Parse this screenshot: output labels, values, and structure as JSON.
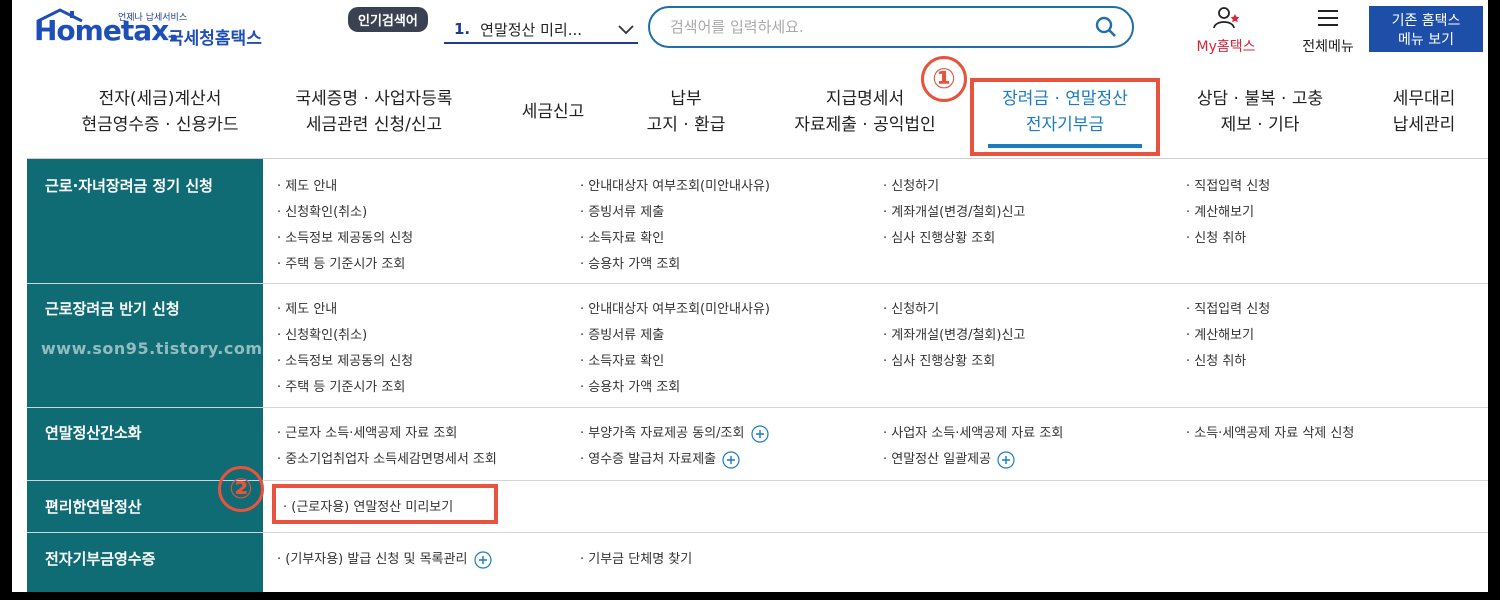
{
  "header": {
    "logo": {
      "tagline": "언제나 납세서비스",
      "brand": "Hometax.",
      "name": "국세청홈택스"
    },
    "popular_label": "인기검색어",
    "popular_rank": "1.",
    "popular_text": "연말정산 미리...",
    "search": {
      "placeholder": "검색어를 입력하세요."
    },
    "my_label": "My홈택스",
    "allmenu_label": "전체메뉴",
    "old_button": {
      "line1": "기존 홈택스",
      "line2": "메뉴 보기"
    }
  },
  "gnb": [
    {
      "line1": "전자(세금)계산서",
      "line2": "현금영수증 · 신용카드"
    },
    {
      "line1": "국세증명 · 사업자등록",
      "line2": "세금관련 신청/신고"
    },
    {
      "line1": "세금신고",
      "line2": ""
    },
    {
      "line1": "납부",
      "line2": "고지 · 환급"
    },
    {
      "line1": "지급명세서",
      "line2": "자료제출 · 공익법인"
    },
    {
      "line1": "장려금 · 연말정산",
      "line2": "전자기부금"
    },
    {
      "line1": "상담 · 불복 · 고충",
      "line2": "제보 · 기타"
    },
    {
      "line1": "세무대리",
      "line2": "납세관리"
    }
  ],
  "annotations": {
    "one": "①",
    "two": "②"
  },
  "watermark": "www.son95.tistory.com",
  "sections": [
    {
      "title": "근로·자녀장려금 정기 신청",
      "links": [
        "· 제도 안내",
        "· 안내대상자 여부조회(미안내사유)",
        "· 신청하기",
        "· 직접입력 신청",
        "· 신청확인(취소)",
        "· 증빙서류 제출",
        "· 계좌개설(변경/철회)신고",
        "· 계산해보기",
        "· 소득정보 제공동의 신청",
        "· 소득자료 확인",
        "· 심사 진행상황 조회",
        "· 신청 취하",
        "· 주택 등 기준시가 조회",
        "· 승용차 가액 조회"
      ]
    },
    {
      "title": "근로장려금 반기 신청",
      "links": [
        "· 제도 안내",
        "· 안내대상자 여부조회(미안내사유)",
        "· 신청하기",
        "· 직접입력 신청",
        "· 신청확인(취소)",
        "· 증빙서류 제출",
        "· 계좌개설(변경/철회)신고",
        "· 계산해보기",
        "· 소득정보 제공동의 신청",
        "· 소득자료 확인",
        "· 심사 진행상황 조회",
        "· 신청 취하",
        "· 주택 등 기준시가 조회",
        "· 승용차 가액 조회"
      ]
    },
    {
      "title": "연말정산간소화",
      "links": [
        "· 근로자 소득·세액공제 자료 조회",
        "· 부양가족 자료제공 동의/조회",
        "· 사업자 소득·세액공제 자료 조회",
        "· 소득·세액공제 자료 삭제 신청",
        "· 중소기업취업자 소득세감면명세서 조회",
        "· 영수증 발급처 자료제출",
        "· 연말정산 일괄제공"
      ]
    },
    {
      "title": "편리한연말정산",
      "links": [
        "· (근로자용) 연말정산 미리보기"
      ]
    },
    {
      "title": "전자기부금영수증",
      "links": [
        "· (기부자용) 발급 신청 및 목록관리",
        "· 기부금 단체명 찾기"
      ]
    }
  ],
  "colors": {
    "teal": "#0f6c74",
    "accent": "#1a7cc1",
    "annotation": "#e8533d",
    "brand": "#1e4fb8"
  }
}
